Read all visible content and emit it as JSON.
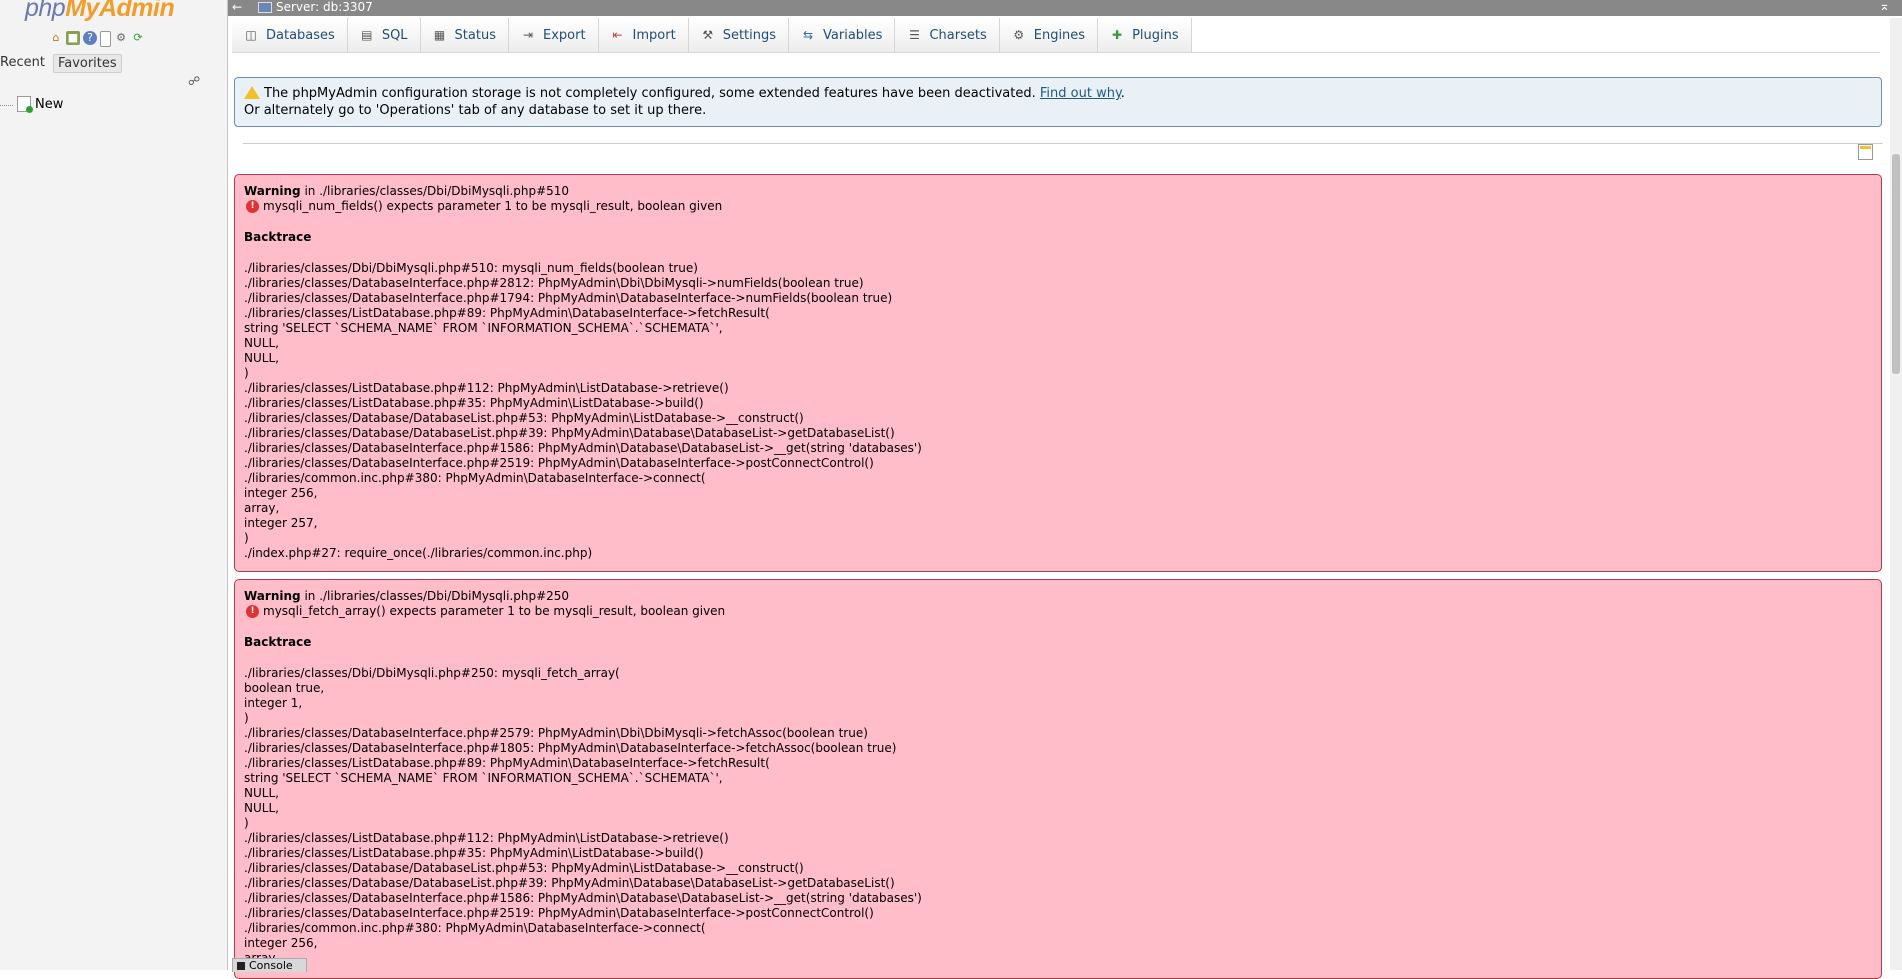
{
  "nav": {
    "logo_php": "php",
    "logo_myadmin": "MyAdmin",
    "icons": [
      "home-icon",
      "logout-icon",
      "help-icon",
      "docs-icon",
      "settings-icon",
      "reload-icon"
    ],
    "tabs": [
      "Recent",
      "Favorites"
    ],
    "tree": [
      {
        "label": "New"
      }
    ]
  },
  "serverbar": {
    "title": "Server: db:3307"
  },
  "tabs": [
    {
      "label": "Databases",
      "icon": "database-icon"
    },
    {
      "label": "SQL",
      "icon": "sql-icon"
    },
    {
      "label": "Status",
      "icon": "status-icon"
    },
    {
      "label": "Export",
      "icon": "export-icon"
    },
    {
      "label": "Import",
      "icon": "import-icon"
    },
    {
      "label": "Settings",
      "icon": "wrench-icon"
    },
    {
      "label": "Variables",
      "icon": "variables-icon"
    },
    {
      "label": "Charsets",
      "icon": "charsets-icon"
    },
    {
      "label": "Engines",
      "icon": "engines-icon"
    },
    {
      "label": "Plugins",
      "icon": "plugins-icon"
    }
  ],
  "notice": {
    "line1": "The phpMyAdmin configuration storage is not completely configured, some extended features have been deactivated. ",
    "link": "Find out why",
    "line1_end": ".",
    "line2": "Or alternately go to 'Operations' tab of any database to set it up there."
  },
  "errors": [
    {
      "prefix": "Warning",
      "location": " in ./libraries/classes/Dbi/DbiMysqli.php#510",
      "message": "mysqli_num_fields() expects parameter 1 to be mysqli_result, boolean given",
      "backtrace_label": "Backtrace",
      "trace": [
        "./libraries/classes/Dbi/DbiMysqli.php#510: mysqli_num_fields(boolean true)",
        "./libraries/classes/DatabaseInterface.php#2812: PhpMyAdmin\\Dbi\\DbiMysqli->numFields(boolean true)",
        "./libraries/classes/DatabaseInterface.php#1794: PhpMyAdmin\\DatabaseInterface->numFields(boolean true)",
        "./libraries/classes/ListDatabase.php#89: PhpMyAdmin\\DatabaseInterface->fetchResult(",
        "string 'SELECT `SCHEMA_NAME` FROM `INFORMATION_SCHEMA`.`SCHEMATA`',",
        "NULL,",
        "NULL,",
        ")",
        "./libraries/classes/ListDatabase.php#112: PhpMyAdmin\\ListDatabase->retrieve()",
        "./libraries/classes/ListDatabase.php#35: PhpMyAdmin\\ListDatabase->build()",
        "./libraries/classes/Database/DatabaseList.php#53: PhpMyAdmin\\ListDatabase->__construct()",
        "./libraries/classes/Database/DatabaseList.php#39: PhpMyAdmin\\Database\\DatabaseList->getDatabaseList()",
        "./libraries/classes/DatabaseInterface.php#1586: PhpMyAdmin\\Database\\DatabaseList->__get(string 'databases')",
        "./libraries/classes/DatabaseInterface.php#2519: PhpMyAdmin\\DatabaseInterface->postConnectControl()",
        "./libraries/common.inc.php#380: PhpMyAdmin\\DatabaseInterface->connect(",
        "integer 256,",
        "array,",
        "integer 257,",
        ")",
        "./index.php#27: require_once(./libraries/common.inc.php)"
      ]
    },
    {
      "prefix": "Warning",
      "location": " in ./libraries/classes/Dbi/DbiMysqli.php#250",
      "message": "mysqli_fetch_array() expects parameter 1 to be mysqli_result, boolean given",
      "backtrace_label": "Backtrace",
      "trace": [
        "./libraries/classes/Dbi/DbiMysqli.php#250: mysqli_fetch_array(",
        "boolean true,",
        "integer 1,",
        ")",
        "./libraries/classes/DatabaseInterface.php#2579: PhpMyAdmin\\Dbi\\DbiMysqli->fetchAssoc(boolean true)",
        "./libraries/classes/DatabaseInterface.php#1805: PhpMyAdmin\\DatabaseInterface->fetchAssoc(boolean true)",
        "./libraries/classes/ListDatabase.php#89: PhpMyAdmin\\DatabaseInterface->fetchResult(",
        "string 'SELECT `SCHEMA_NAME` FROM `INFORMATION_SCHEMA`.`SCHEMATA`',",
        "NULL,",
        "NULL,",
        ")",
        "./libraries/classes/ListDatabase.php#112: PhpMyAdmin\\ListDatabase->retrieve()",
        "./libraries/classes/ListDatabase.php#35: PhpMyAdmin\\ListDatabase->build()",
        "./libraries/classes/Database/DatabaseList.php#53: PhpMyAdmin\\ListDatabase->__construct()",
        "./libraries/classes/Database/DatabaseList.php#39: PhpMyAdmin\\Database\\DatabaseList->getDatabaseList()",
        "./libraries/classes/DatabaseInterface.php#1586: PhpMyAdmin\\Database\\DatabaseList->__get(string 'databases')",
        "./libraries/classes/DatabaseInterface.php#2519: PhpMyAdmin\\DatabaseInterface->postConnectControl()",
        "./libraries/common.inc.php#380: PhpMyAdmin\\DatabaseInterface->connect(",
        "integer 256,",
        "array,"
      ]
    }
  ],
  "console": {
    "label": "Console"
  }
}
